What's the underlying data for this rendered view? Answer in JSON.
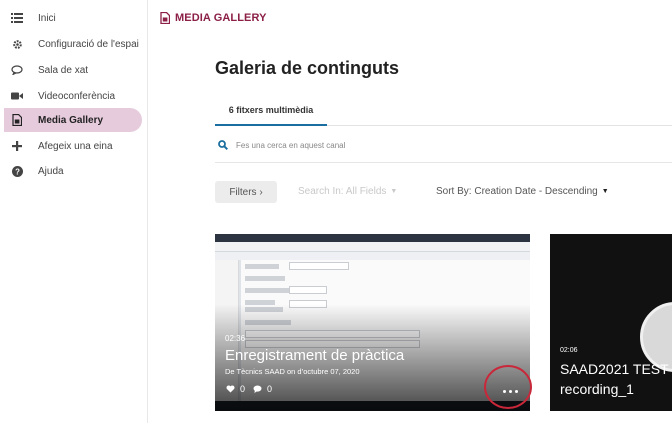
{
  "sidebar": {
    "items": [
      {
        "label": "Inici",
        "icon": "list-icon"
      },
      {
        "label": "Configuració de l'espai",
        "icon": "gear-icon"
      },
      {
        "label": "Sala de xat",
        "icon": "chat-icon"
      },
      {
        "label": "Videoconferència",
        "icon": "video-camera-icon"
      },
      {
        "label": "Media Gallery",
        "icon": "media-gallery-icon",
        "active": true
      },
      {
        "label": "Afegeix una eina",
        "icon": "plus-icon"
      },
      {
        "label": "Ajuda",
        "icon": "help-icon"
      }
    ]
  },
  "header": {
    "brand": "MEDIA GALLERY",
    "title": "Galeria de continguts"
  },
  "tabs": [
    {
      "label": "6 fitxers multimèdia",
      "active": true
    }
  ],
  "search": {
    "placeholder": "Fes una cerca en aquest canal"
  },
  "toolbar": {
    "filters_label": "Filters ›",
    "search_in_label": "Search In: All Fields",
    "sort_label": "Sort By: Creation Date - Descending"
  },
  "cards": [
    {
      "duration": "02:36",
      "title": "Enregistrament de pràctica",
      "subtitle": "De Tècnics SAAD on d’octubre 07, 2020",
      "likes": "0",
      "comments": "0"
    },
    {
      "duration": "02:06",
      "title_line1": "SAAD2021 TEST",
      "title_line2": "recording_1"
    }
  ],
  "colors": {
    "brand": "#8b1f46",
    "active_nav_bg": "#e6cbdc",
    "tab_underline": "#1b6fa0",
    "search_icon": "#1b6fa0",
    "highlight_ring": "#c9273a"
  }
}
